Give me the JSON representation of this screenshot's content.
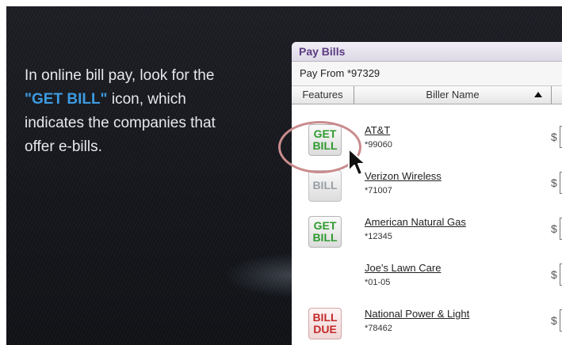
{
  "caption": {
    "line1": "In online bill pay, look for the",
    "highlight": "\"GET BILL\"",
    "line2_rest": " icon, which",
    "line3": "indicates the companies that",
    "line4": "offer e-bills."
  },
  "panel": {
    "title": "Pay Bills",
    "pay_from": "Pay From *97329",
    "columns": {
      "features": "Features",
      "biller_name": "Biller Name"
    },
    "currency": "$",
    "billers": [
      {
        "name": "AT&T",
        "account": "*99060",
        "feature": "GET BILL",
        "feature_line1": "GET",
        "feature_line2": "BILL"
      },
      {
        "name": "Verizon Wireless",
        "account": "*71007",
        "feature": "BILL",
        "feature_line1": "BILL",
        "feature_line2": ""
      },
      {
        "name": "American Natural Gas",
        "account": "*12345",
        "feature": "GET BILL",
        "feature_line1": "GET",
        "feature_line2": "BILL"
      },
      {
        "name": "Joe's Lawn Care",
        "account": "*01-05",
        "feature": "",
        "feature_line1": "",
        "feature_line2": ""
      },
      {
        "name": "National Power & Light",
        "account": "*78462",
        "feature": "BILL DUE",
        "feature_line1": "BILL",
        "feature_line2": "DUE"
      }
    ]
  },
  "icons": {
    "sort": "sort-ascending-icon",
    "pointer": "mouse-pointer-icon",
    "highlight": "red-circle-highlight"
  },
  "colors": {
    "accent": "#3c9be0",
    "title": "#5b3b82",
    "get_bill": "#2f9a2f",
    "bill_due": "#c42a2a",
    "circle": "#c98b8d"
  }
}
